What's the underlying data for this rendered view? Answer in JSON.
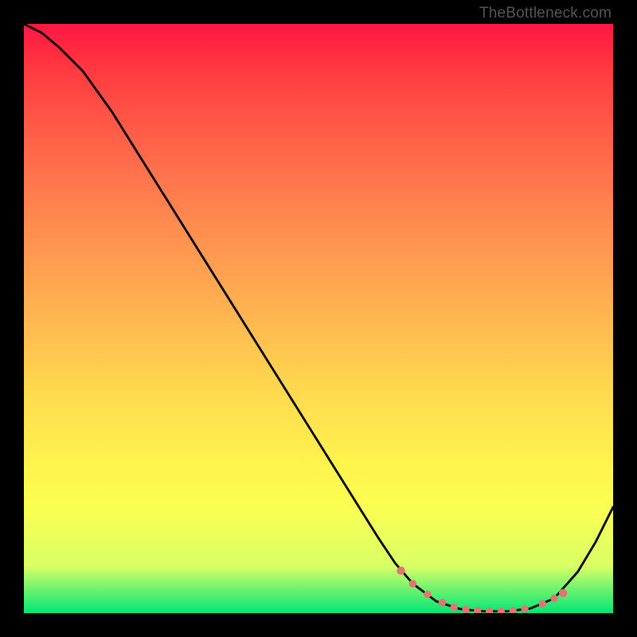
{
  "attribution": "TheBottleneck.com",
  "colors": {
    "background": "#000000",
    "gradient_top": "#ff1744",
    "gradient_bottom": "#00e676",
    "curve": "#000000",
    "markers": "#e57373"
  },
  "chart_data": {
    "type": "line",
    "title": "",
    "xlabel": "",
    "ylabel": "",
    "xlim": [
      0,
      100
    ],
    "ylim": [
      0,
      100
    ],
    "series": [
      {
        "name": "bottleneck-curve",
        "x": [
          0,
          3,
          6,
          10,
          15,
          20,
          25,
          30,
          35,
          40,
          45,
          50,
          55,
          60,
          63,
          66,
          70,
          74,
          78,
          82,
          86,
          90,
          94,
          97,
          100
        ],
        "y": [
          100,
          98.5,
          96,
          92,
          85,
          77,
          69,
          61,
          53,
          45,
          37,
          29,
          21,
          13,
          8.5,
          5,
          2,
          0.7,
          0.3,
          0.3,
          0.8,
          2.5,
          7,
          12,
          18
        ]
      }
    ],
    "markers": {
      "name": "bottleneck-sweet-spot",
      "x": [
        64,
        66,
        68.5,
        71,
        73,
        75,
        77,
        79,
        81,
        83,
        85,
        88,
        90,
        91.5
      ],
      "y": [
        7.2,
        5,
        3.2,
        1.8,
        1.0,
        0.6,
        0.4,
        0.3,
        0.3,
        0.4,
        0.7,
        1.6,
        2.5,
        3.4
      ]
    }
  }
}
